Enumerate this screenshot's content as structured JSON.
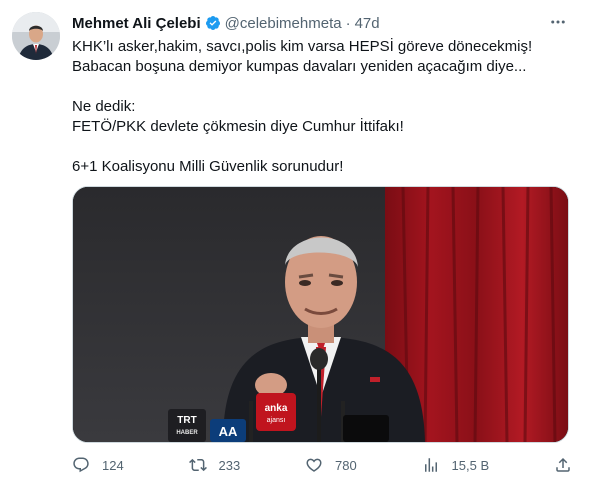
{
  "author": {
    "name": "Mehmet Ali Çelebi",
    "handle": "@celebimehmeta",
    "separator": "·",
    "time": "47d"
  },
  "tweet": {
    "lines_block1": [
      "KHK’lı asker,hakim, savcı,polis kim varsa HEPSİ göreve dönecekmiş!",
      "Babacan boşuna demiyor kumpas davaları yeniden açacağım diye..."
    ],
    "lines_block2": [
      "Ne dedik:",
      "FETÖ/PKK devlete çökmesin diye Cumhur İttifakı!"
    ],
    "lines_block3": [
      "6+1 Koalisyonu Milli Güvenlik sorunudur!"
    ]
  },
  "media": {
    "mic_labels": {
      "trt": "TRT",
      "trt_sub": "HABER",
      "aa": "AA",
      "anka": "anka",
      "anka_sub": "ajansı"
    }
  },
  "actions": {
    "reply_count": "124",
    "retweet_count": "233",
    "like_count": "780",
    "views_count": "15,5 B"
  },
  "colors": {
    "accent": "#1d9bf0",
    "text_secondary": "#536471",
    "border": "#cfd9de"
  }
}
